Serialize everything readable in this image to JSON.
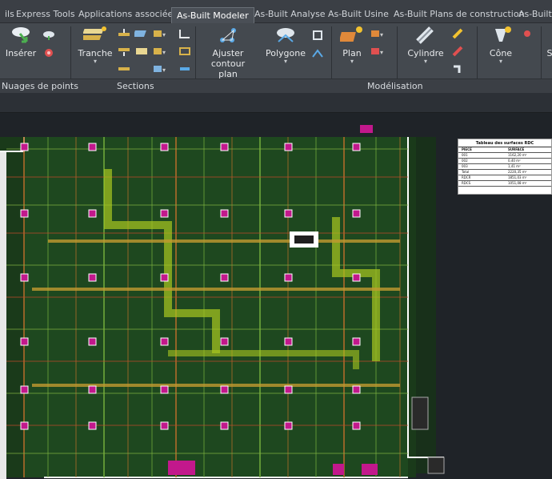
{
  "tabs": [
    {
      "label": "ils",
      "active": false
    },
    {
      "label": "Express Tools",
      "active": false
    },
    {
      "label": "Applications associées",
      "active": false
    },
    {
      "label": "As-Built Modeler",
      "active": true
    },
    {
      "label": "As-Built Analyse",
      "active": false
    },
    {
      "label": "As-Built Usine",
      "active": false
    },
    {
      "label": "As-Built Plans de construction",
      "active": false
    },
    {
      "label": "As-Built S",
      "active": false
    }
  ],
  "ribbon": {
    "inserer_label": "Insérer",
    "tranche_label": "Tranche",
    "ajuster_label_line1": "Ajuster contour",
    "ajuster_label_line2": "plan",
    "polygone_label": "Polygone",
    "plan_label": "Plan",
    "cylindre_label": "Cylindre",
    "cone_label": "Cône",
    "edge_label": "S",
    "groups": {
      "nuages": "Nuages de points",
      "sections": "Sections",
      "modelisation": "Modélisation"
    },
    "colors": {
      "accent_yellow": "#f2c230",
      "accent_blue": "#5aa9e6",
      "accent_green": "#4caf50",
      "accent_red": "#e05050"
    }
  },
  "drawing": {
    "table": {
      "title": "Tableau des surfaces RDC",
      "headers": [
        "PIECE",
        "SURFACE"
      ],
      "rows": [
        [
          "001",
          "1162,20 m²"
        ],
        [
          "002",
          "0,40 m²"
        ],
        [
          "003",
          "1,41 m²"
        ],
        [
          "Total",
          "2220,35 m²"
        ],
        [
          "RDCR",
          "1851,03 m²"
        ],
        [
          "RDCS",
          "1051,08 m²"
        ]
      ]
    }
  }
}
